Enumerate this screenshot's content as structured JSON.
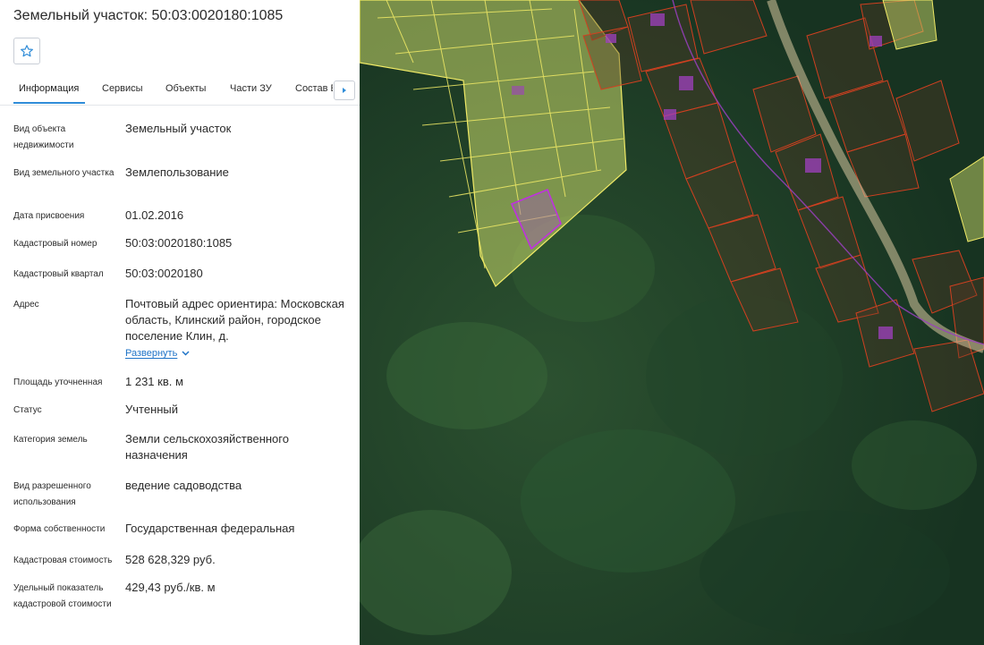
{
  "header": {
    "title": "Земельный участок: 50:03:0020180:1085"
  },
  "favorite": {
    "icon": "star-icon"
  },
  "tabs": [
    {
      "label": "Информация",
      "active": true
    },
    {
      "label": "Сервисы"
    },
    {
      "label": "Объекты"
    },
    {
      "label": "Части ЗУ"
    },
    {
      "label": "Состав Е"
    }
  ],
  "info": {
    "object_type": {
      "label": "Вид объекта недвижимости",
      "value": "Земельный участок"
    },
    "land_type": {
      "label": "Вид земельного участка",
      "value": "Землепользование"
    },
    "assigned_date": {
      "label": "Дата присвоения",
      "value": "01.02.2016"
    },
    "cadastral_no": {
      "label": "Кадастровый номер",
      "value": "50:03:0020180:1085"
    },
    "quarter": {
      "label": "Кадастровый квартал",
      "value": "50:03:0020180"
    },
    "address": {
      "label": "Адрес",
      "value": "Почтовый адрес ориентира: Московская область, Клинский район, городское поселение Клин, д.",
      "expand_label": "Развернуть"
    },
    "area": {
      "label": "Площадь уточненная",
      "value": "1 231 кв. м"
    },
    "status": {
      "label": "Статус",
      "value": "Учтенный"
    },
    "category": {
      "label": "Категория земель",
      "value": "Земли сельскохозяйственного назначения"
    },
    "permitted_use": {
      "label": "Вид разрешенного использования",
      "value": "ведение садоводства"
    },
    "ownership": {
      "label": "Форма собственности",
      "value": "Государственная федеральная"
    },
    "cost": {
      "label": "Кадастровая стоимость",
      "value": "528 628,329 руб."
    },
    "unit_cost": {
      "label": "Удельный показатель кадастровой стоимости",
      "value": "429,43 руб./кв. м"
    }
  },
  "colors": {
    "accent": "#2f8cd8",
    "link": "#1e73c7",
    "parcel_fill": "#c8d86a",
    "parcel_edge": "#f0ea66",
    "neighbor_edge": "#d04020",
    "selected_edge": "#c030e0",
    "building": "#a040c0"
  }
}
